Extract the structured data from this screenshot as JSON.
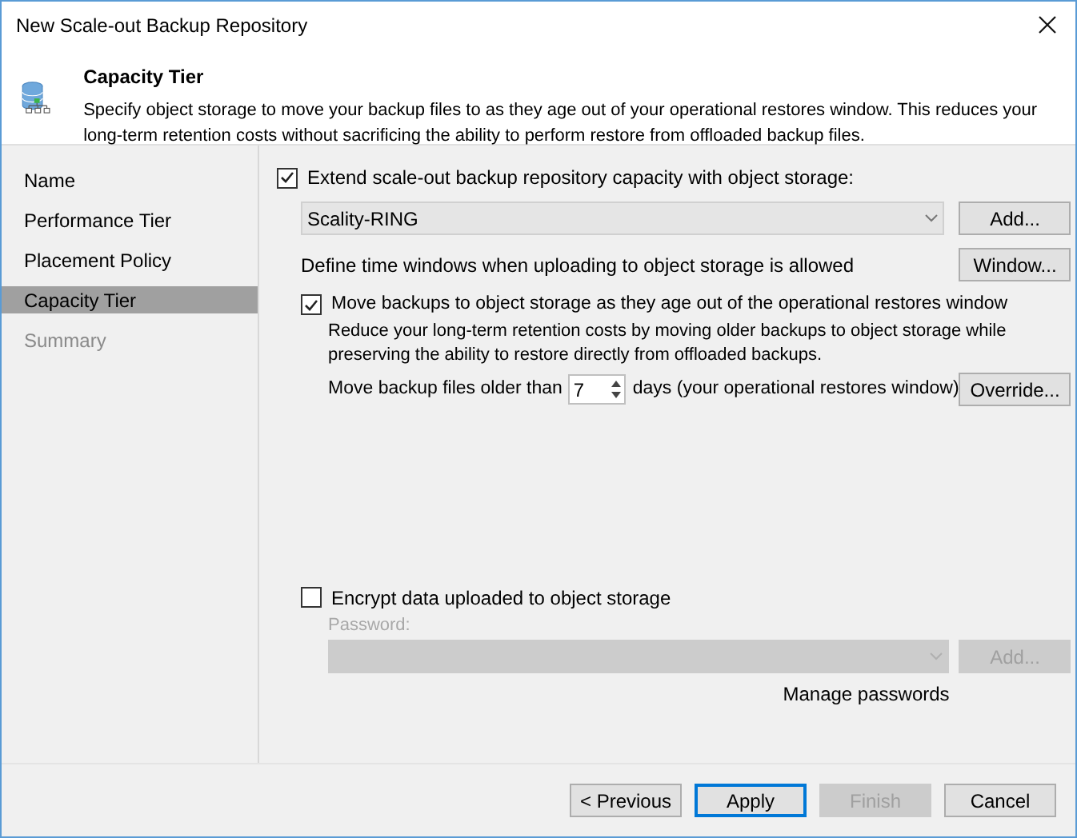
{
  "window": {
    "title": "New Scale-out Backup Repository"
  },
  "header": {
    "title": "Capacity Tier",
    "description": "Specify object storage to move your backup files to as they age out of your operational restores window. This reduces your long-term retention costs without sacrificing the ability to perform restore from offloaded backup files."
  },
  "steps": [
    {
      "label": "Name",
      "selected": false,
      "disabled": false
    },
    {
      "label": "Performance Tier",
      "selected": false,
      "disabled": false
    },
    {
      "label": "Placement Policy",
      "selected": false,
      "disabled": false
    },
    {
      "label": "Capacity Tier",
      "selected": true,
      "disabled": false
    },
    {
      "label": "Summary",
      "selected": false,
      "disabled": true
    }
  ],
  "object_storage": {
    "checked": true,
    "label": "Extend scale-out backup repository capacity with object storage:",
    "value": "Scality-RING",
    "add_button": "Add..."
  },
  "upload_window": {
    "label": "Define time windows when uploading to object storage is allowed",
    "button": "Window..."
  },
  "move": {
    "checked": true,
    "label": "Move backups to object storage as they age out of the operational restores window",
    "description": "Reduce your long-term retention costs by moving older backups to object storage while preserving the ability to restore directly from offloaded backups.",
    "days_prefix": "Move backup files older than",
    "days_value": "7",
    "days_suffix": "days (your operational restores window)",
    "override_button": "Override..."
  },
  "encrypt": {
    "checked": false,
    "label": "Encrypt data uploaded to object storage",
    "password_label": "Password:",
    "add_button": "Add...",
    "manage_link": "Manage passwords"
  },
  "buttons": [
    {
      "label": "< Previous",
      "default": false,
      "disabled": false
    },
    {
      "label": "Apply",
      "default": true,
      "disabled": false
    },
    {
      "label": "Finish",
      "default": false,
      "disabled": true
    },
    {
      "label": "Cancel",
      "default": false,
      "disabled": false
    }
  ]
}
